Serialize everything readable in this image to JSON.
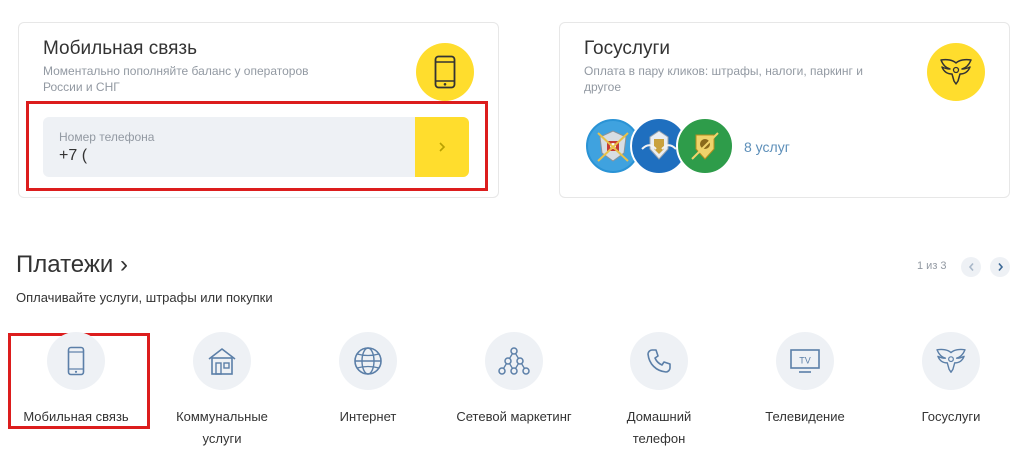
{
  "mobile_card": {
    "title": "Мобильная связь",
    "description": "Моментально пополняйте баланс у операторов России и СНГ",
    "icon": "smartphone-icon",
    "phone_label": "Номер телефона",
    "phone_value": "+7 (",
    "submit_icon": "chevron-right-icon"
  },
  "gos_card": {
    "title": "Госуслуги",
    "description": "Оплата в пару кликов: штрафы, налоги, паркинг и другое",
    "icon": "eagle-emblem-icon",
    "badges": [
      {
        "icon": "traffic-police-emblem-icon",
        "color": "#2a93d5"
      },
      {
        "icon": "tax-service-emblem-icon",
        "color": "#1f6fbf"
      },
      {
        "icon": "bailiff-service-emblem-icon",
        "color": "#2e9c4a"
      }
    ],
    "services_link": "8 услуг"
  },
  "payments": {
    "title": "Платежи",
    "title_arrow": "›",
    "subtitle": "Оплачивайте услуги, штрафы или покупки",
    "pager": "1 из 3",
    "prev_icon": "chevron-left-icon",
    "next_icon": "chevron-right-icon",
    "categories": [
      {
        "label": "Мобильная связь",
        "icon": "smartphone-icon"
      },
      {
        "label": "Коммунальные услуги",
        "icon": "house-icon"
      },
      {
        "label": "Интернет",
        "icon": "globe-icon"
      },
      {
        "label": "Сетевой маркетинг",
        "icon": "network-icon"
      },
      {
        "label": "Домашний телефон",
        "icon": "phone-handset-icon"
      },
      {
        "label": "Телевидение",
        "icon": "tv-icon"
      },
      {
        "label": "Госуслуги",
        "icon": "eagle-emblem-icon"
      }
    ]
  },
  "colors": {
    "accent_yellow": "#ffdd2d",
    "field_bg": "#eef1f5",
    "highlight_red": "#dc1d1d",
    "link_blue": "#5d8fb9",
    "icon_blue": "#5b7fa8",
    "muted_text": "#9299a2"
  }
}
